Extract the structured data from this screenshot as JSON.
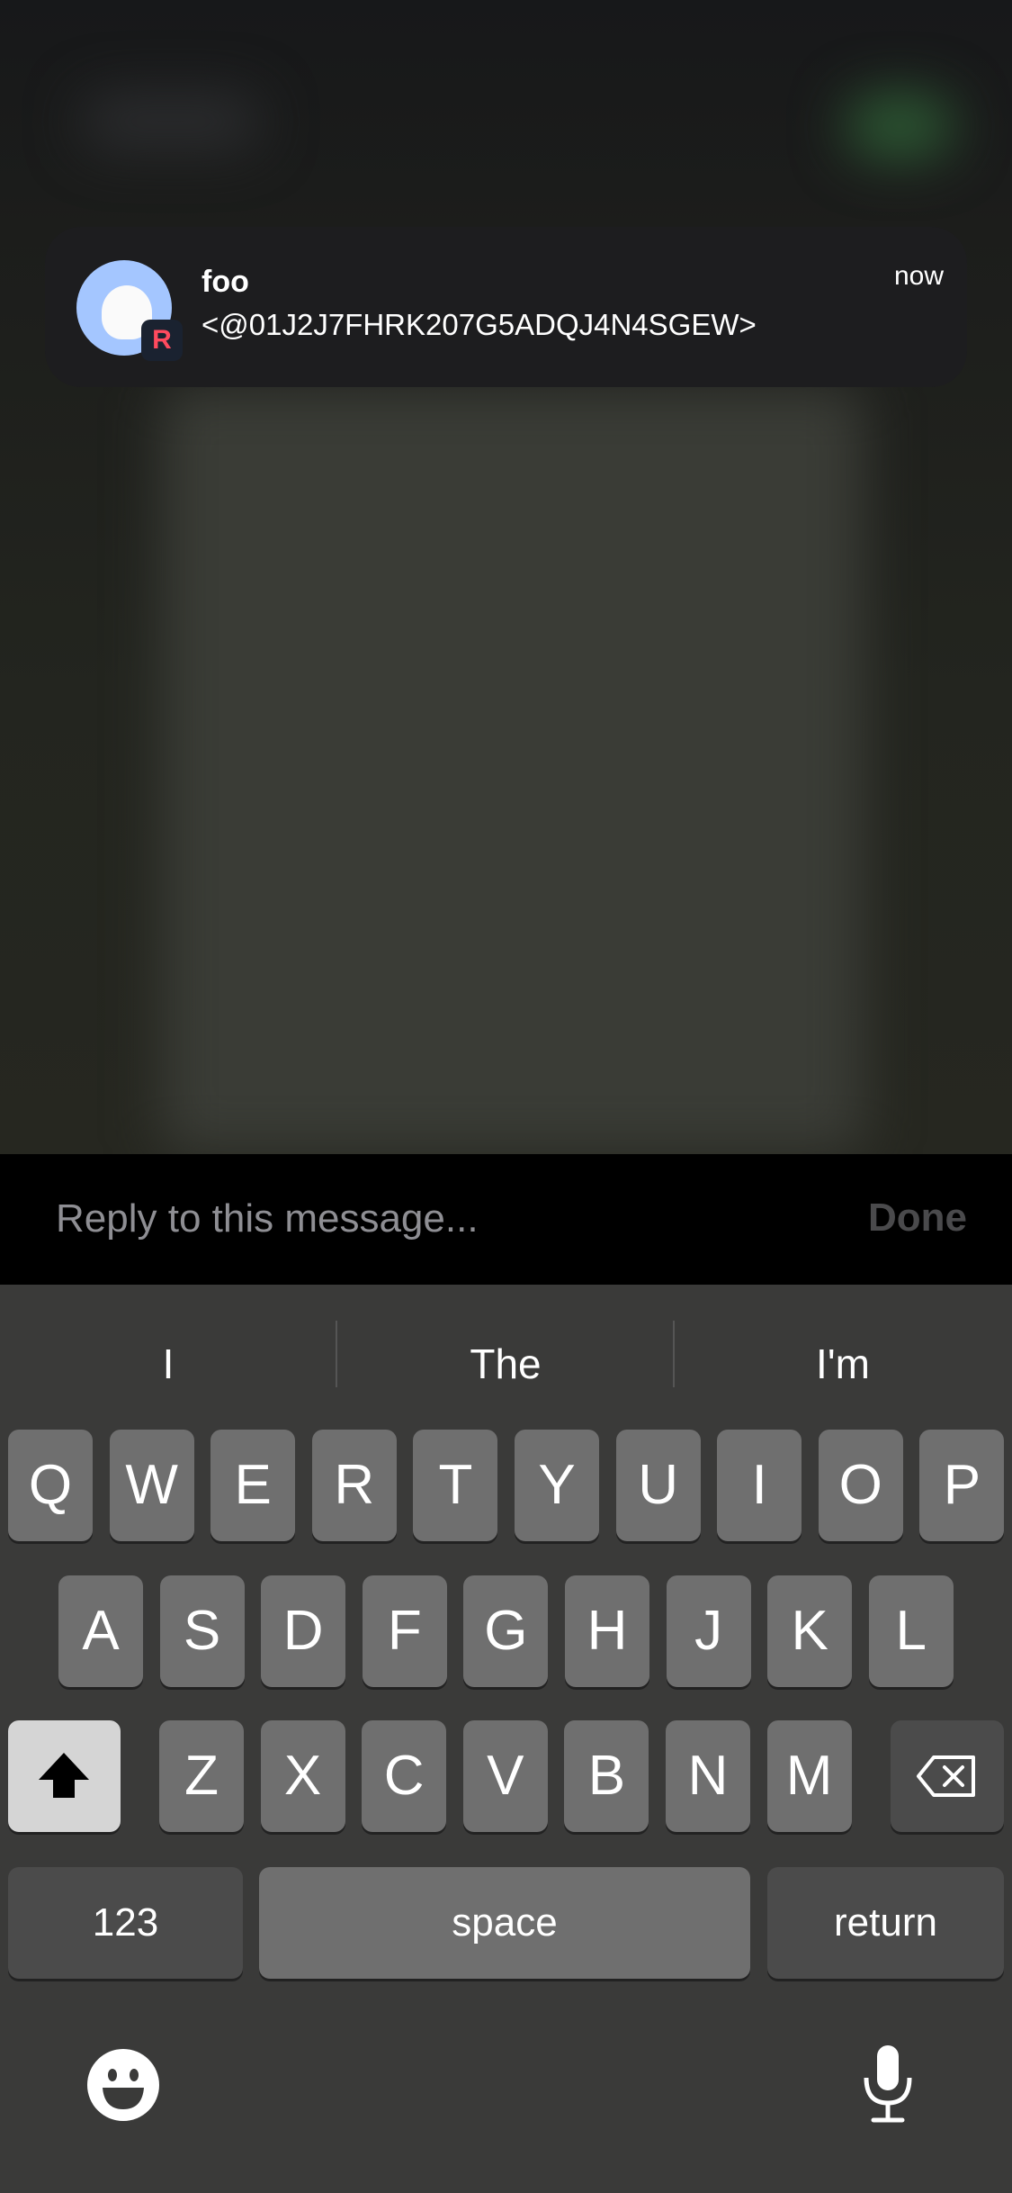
{
  "notification": {
    "title": "foo",
    "body": "<@01J2J7FHRK207G5ADQJ4N4SGEW>",
    "time": "now",
    "badge_letter": "R",
    "app_icon": "revolt-r-badge"
  },
  "reply": {
    "placeholder": "Reply to this message...",
    "done_label": "Done"
  },
  "keyboard": {
    "suggestions": [
      "I",
      "The",
      "I'm"
    ],
    "row1": [
      "Q",
      "W",
      "E",
      "R",
      "T",
      "Y",
      "U",
      "I",
      "O",
      "P"
    ],
    "row2": [
      "A",
      "S",
      "D",
      "F",
      "G",
      "H",
      "J",
      "K",
      "L"
    ],
    "row3": [
      "Z",
      "X",
      "C",
      "V",
      "B",
      "N",
      "M"
    ],
    "numbers_label": "123",
    "space_label": "space",
    "return_label": "return"
  },
  "colors": {
    "avatar": "#a4c6ff",
    "badge_letter": "#ff4a5e",
    "key": "#6f6f6f",
    "special_key": "#4b4b4b"
  }
}
